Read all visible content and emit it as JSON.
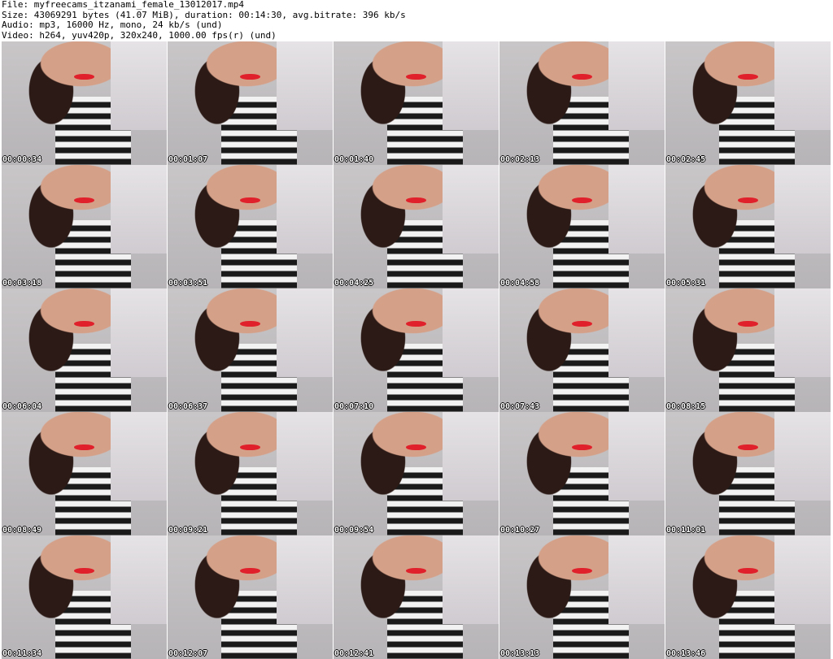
{
  "header": {
    "file_line": "File: myfreecams_itzanami_female_13012017.mp4",
    "size_line": "Size: 43069291 bytes (41.07 MiB), duration: 00:14:30, avg.bitrate: 396 kb/s",
    "audio_line": "Audio: mp3, 16000 Hz, mono, 24 kb/s (und)",
    "video_line": "Video: h264, yuv420p, 320x240, 1000.00 fps(r) (und)"
  },
  "thumbnails": [
    {
      "timestamp": "00:00:34"
    },
    {
      "timestamp": "00:01:07"
    },
    {
      "timestamp": "00:01:40"
    },
    {
      "timestamp": "00:02:13"
    },
    {
      "timestamp": "00:02:45"
    },
    {
      "timestamp": "00:03:18"
    },
    {
      "timestamp": "00:03:51"
    },
    {
      "timestamp": "00:04:25"
    },
    {
      "timestamp": "00:04:58"
    },
    {
      "timestamp": "00:05:31"
    },
    {
      "timestamp": "00:06:04"
    },
    {
      "timestamp": "00:06:37"
    },
    {
      "timestamp": "00:07:10"
    },
    {
      "timestamp": "00:07:43"
    },
    {
      "timestamp": "00:08:15"
    },
    {
      "timestamp": "00:08:49"
    },
    {
      "timestamp": "00:09:21"
    },
    {
      "timestamp": "00:09:54"
    },
    {
      "timestamp": "00:10:27"
    },
    {
      "timestamp": "00:11:01"
    },
    {
      "timestamp": "00:11:34"
    },
    {
      "timestamp": "00:12:07"
    },
    {
      "timestamp": "00:12:41"
    },
    {
      "timestamp": "00:13:13"
    },
    {
      "timestamp": "00:13:46"
    }
  ]
}
